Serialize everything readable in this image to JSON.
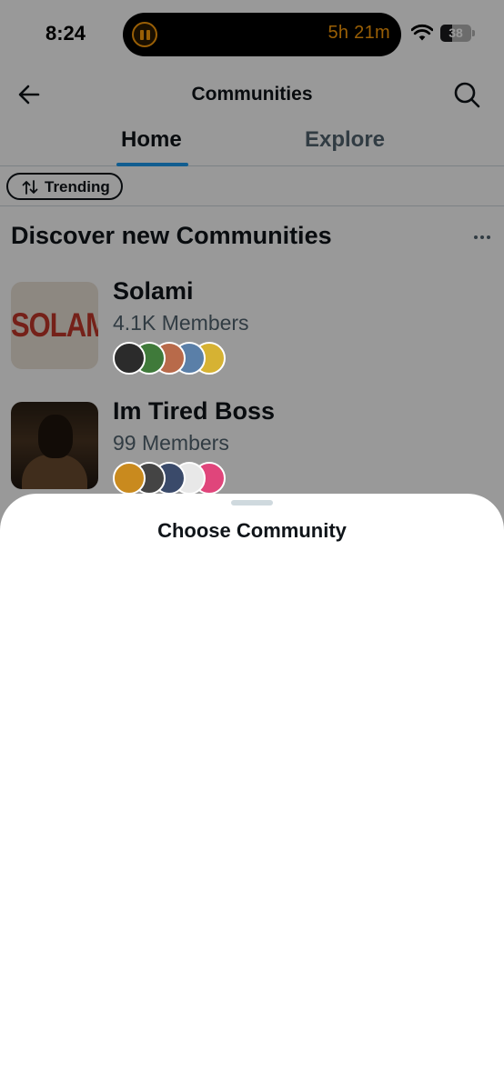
{
  "status_bar": {
    "time": "8:24",
    "timer": "5h 21m",
    "battery": "38",
    "battery_level": 0.38
  },
  "nav": {
    "title": "Communities"
  },
  "tabs": [
    {
      "label": "Home",
      "active": true
    },
    {
      "label": "Explore",
      "active": false
    }
  ],
  "filter": {
    "label": "Trending"
  },
  "section": {
    "title": "Discover new Communities"
  },
  "communities": [
    {
      "name": "Solami",
      "members": "4.1K Members",
      "thumbnail_text": "SOLAMI",
      "avatar_colors": [
        "#2b2b2b",
        "#3f7a3a",
        "#b86a4a",
        "#5a7fa8",
        "#d6b233"
      ]
    },
    {
      "name": "Im Tired Boss",
      "members": "99 Members",
      "avatar_colors": [
        "#c98a1e",
        "#444444",
        "#3a4a6a",
        "#e8e8e8",
        "#e0457b"
      ]
    }
  ],
  "sheet": {
    "title": "Choose Community"
  },
  "colors": {
    "accent": "#1d9bf0",
    "timer": "#ff9f0a",
    "scrim": "rgba(0,0,0,0.4)"
  },
  "icons": [
    "back-arrow-icon",
    "search-icon",
    "sort-icon",
    "more-horizontal-icon",
    "wifi-icon",
    "pause-icon"
  ]
}
